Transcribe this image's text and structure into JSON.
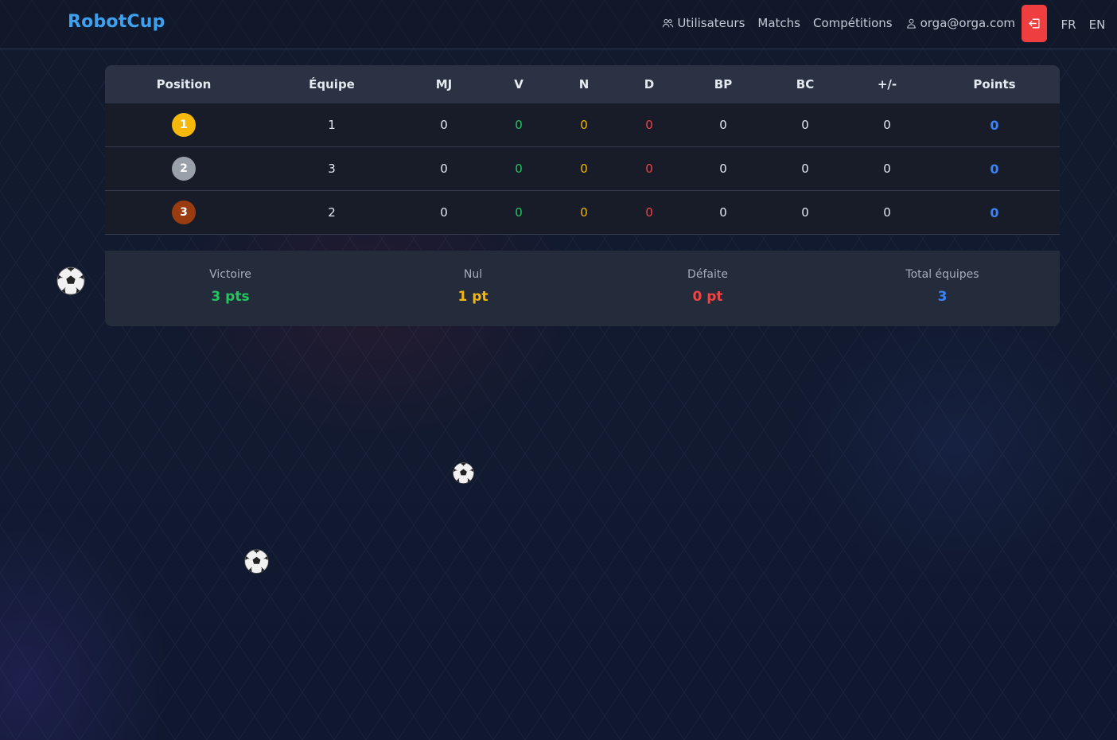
{
  "brand": "RobotCup",
  "nav": {
    "users": "Utilisateurs",
    "matches": "Matchs",
    "competitions": "Compétitions",
    "account": "orga@orga.com",
    "lang_fr": "FR",
    "lang_en": "EN"
  },
  "table": {
    "headers": [
      "Position",
      "Équipe",
      "MJ",
      "V",
      "N",
      "D",
      "BP",
      "BC",
      "+/-",
      "Points"
    ],
    "rows": [
      {
        "position": "1",
        "team": "1",
        "mj": "0",
        "v": "0",
        "n": "0",
        "d": "0",
        "bp": "0",
        "bc": "0",
        "diff": "0",
        "points": "0",
        "medal_color": "#f5b80b"
      },
      {
        "position": "2",
        "team": "3",
        "mj": "0",
        "v": "0",
        "n": "0",
        "d": "0",
        "bp": "0",
        "bc": "0",
        "diff": "0",
        "points": "0",
        "medal_color": "#9aa0aa"
      },
      {
        "position": "3",
        "team": "2",
        "mj": "0",
        "v": "0",
        "n": "0",
        "d": "0",
        "bp": "0",
        "bc": "0",
        "diff": "0",
        "points": "0",
        "medal_color": "#9a3c12"
      }
    ]
  },
  "stats": [
    {
      "label": "Victoire",
      "value": "3 pts",
      "color": "#22c55e"
    },
    {
      "label": "Nul",
      "value": "1 pt",
      "color": "#f5b60b"
    },
    {
      "label": "Défaite",
      "value": "0 pt",
      "color": "#ef4444"
    },
    {
      "label": "Total équipes",
      "value": "3",
      "color": "#3b82f6"
    }
  ],
  "colors": {
    "brand": "#3ea0f0",
    "logout": "#ef3e40",
    "win": "#22c55e",
    "draw": "#f5b60b",
    "loss": "#ef4444",
    "points": "#3b82f6"
  },
  "decorations": [
    "soccer-ball-icon",
    "soccer-ball-icon",
    "soccer-ball-icon"
  ]
}
